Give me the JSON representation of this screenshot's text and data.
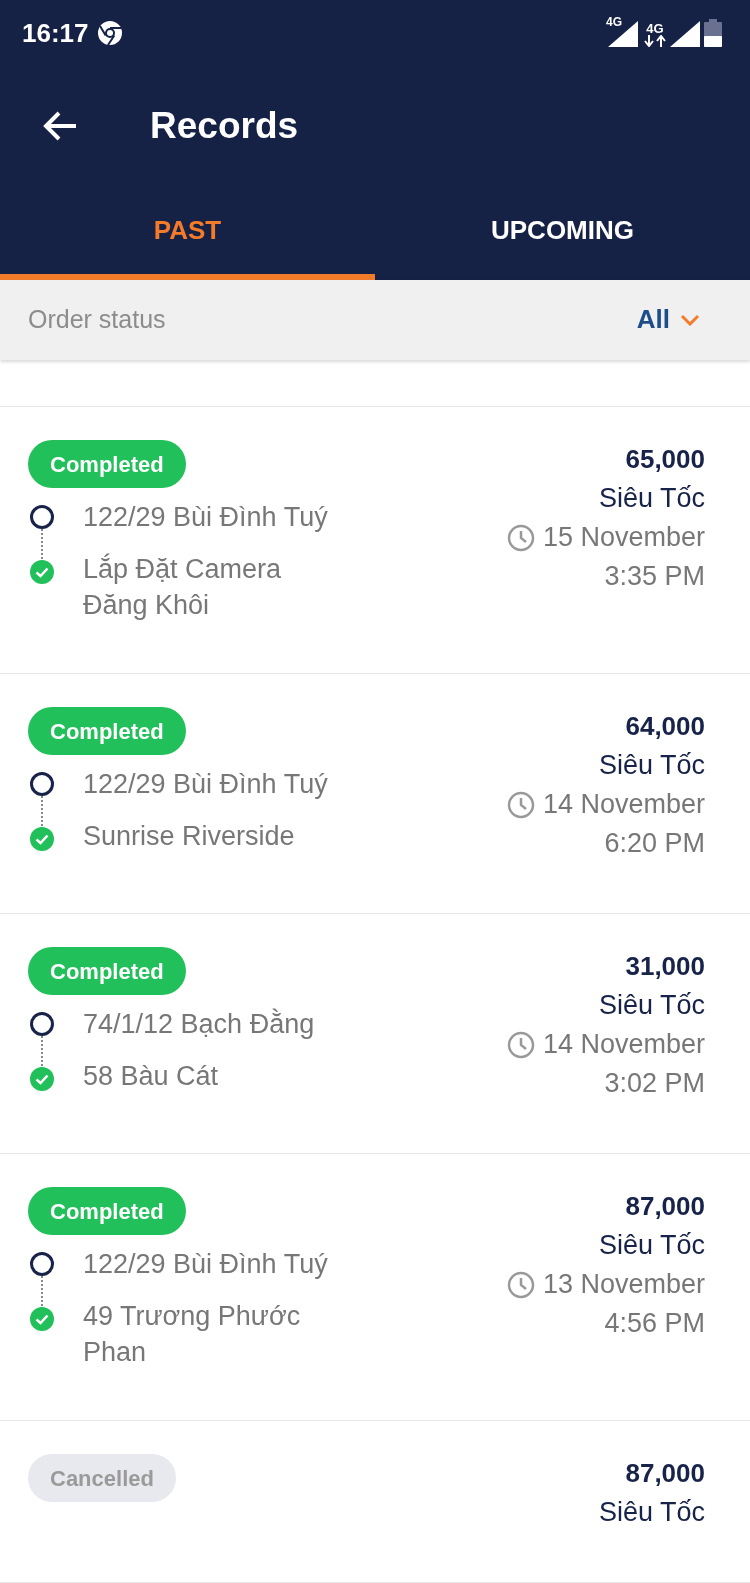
{
  "status_bar": {
    "time": "16:17",
    "network_1": "4G",
    "network_2": "4G"
  },
  "header": {
    "title": "Records"
  },
  "tabs": [
    {
      "label": "PAST",
      "selected": true
    },
    {
      "label": "UPCOMING",
      "selected": false
    }
  ],
  "filter": {
    "label": "Order status",
    "value": "All"
  },
  "orders": [
    {
      "kind": "completed",
      "status": "Completed",
      "pickup": "122/29 Bùi Đình Tuý",
      "dropoff": "Lắp Đặt Camera Đăng Khôi",
      "price": "65,000",
      "service": "Siêu Tốc",
      "date": "15 November",
      "time": "3:35 PM"
    },
    {
      "kind": "completed",
      "status": "Completed",
      "pickup": "122/29 Bùi Đình Tuý",
      "dropoff": "Sunrise Riverside",
      "price": "64,000",
      "service": "Siêu Tốc",
      "date": "14 November",
      "time": "6:20 PM"
    },
    {
      "kind": "completed",
      "status": "Completed",
      "pickup": "74/1/12 Bạch Đằng",
      "dropoff": "58 Bàu Cát",
      "price": "31,000",
      "service": "Siêu Tốc",
      "date": "14 November",
      "time": "3:02 PM"
    },
    {
      "kind": "completed",
      "status": "Completed",
      "pickup": "122/29 Bùi Đình Tuý",
      "dropoff": "49 Trương Phước Phan",
      "price": "87,000",
      "service": "Siêu Tốc",
      "date": "13 November",
      "time": "4:56 PM"
    },
    {
      "kind": "cancelled",
      "status": "Cancelled",
      "price": "87,000",
      "service": "Siêu Tốc"
    }
  ]
}
